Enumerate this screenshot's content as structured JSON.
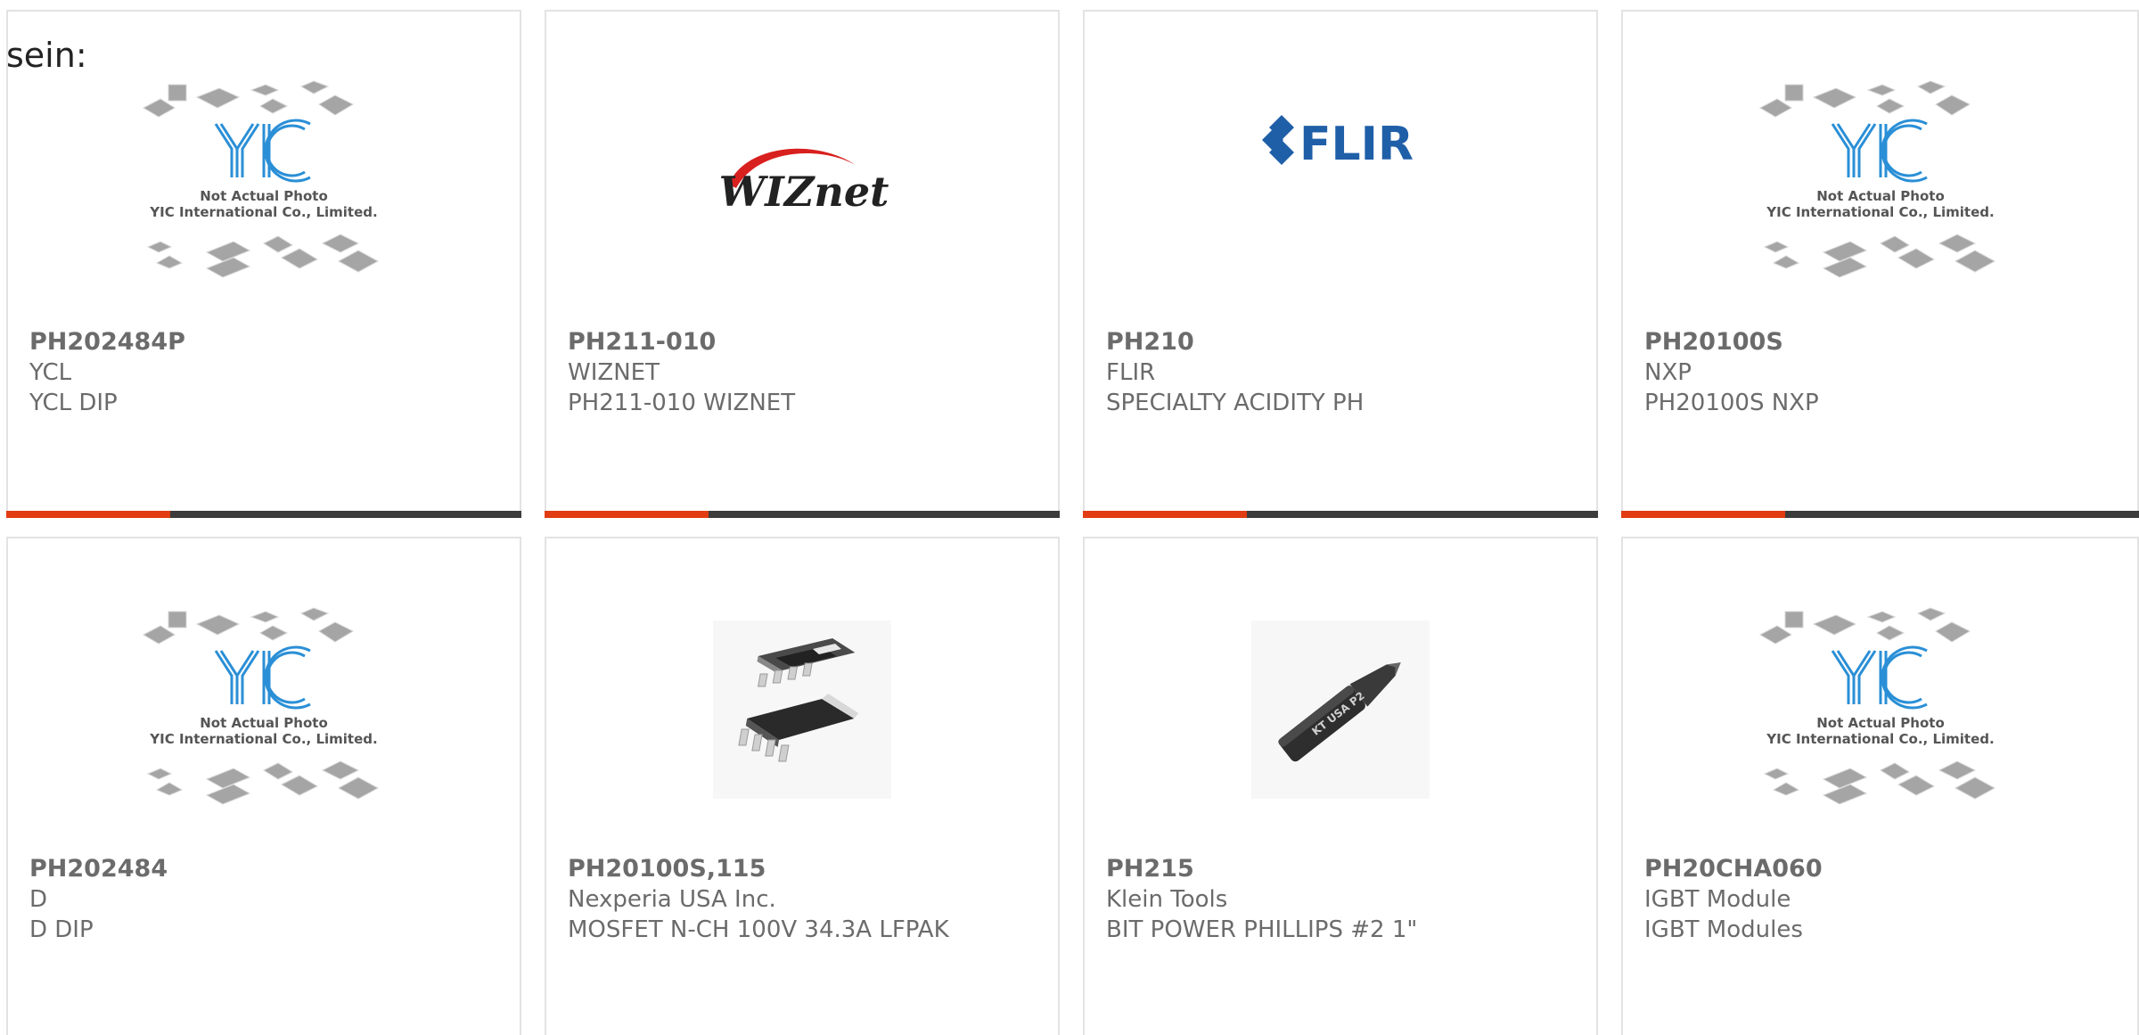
{
  "intro_text": "sein:",
  "products": [
    {
      "part": "PH202484P",
      "maker": "YCL",
      "desc": "YCL DIP",
      "image": "yic-placeholder",
      "placeholder_line1": "Not Actual Photo",
      "placeholder_line2": "YIC International Co., Limited.",
      "has_bar": true
    },
    {
      "part": "PH211-010",
      "maker": "WIZNET",
      "desc": "PH211-010 WIZNET",
      "image": "wiznet-logo",
      "logo_text": "WIZnet",
      "has_bar": true
    },
    {
      "part": "PH210",
      "maker": "FLIR",
      "desc": "SPECIALTY ACIDITY PH",
      "image": "flir-logo",
      "logo_text": "FLIR",
      "has_bar": true
    },
    {
      "part": "PH20100S",
      "maker": "NXP",
      "desc": "PH20100S NXP",
      "image": "yic-placeholder",
      "placeholder_line1": "Not Actual Photo",
      "placeholder_line2": "YIC International Co., Limited.",
      "has_bar": true
    },
    {
      "part": "PH202484",
      "maker": "D",
      "desc": "D DIP",
      "image": "yic-placeholder",
      "placeholder_line1": "Not Actual Photo",
      "placeholder_line2": "YIC International Co., Limited.",
      "has_bar": false
    },
    {
      "part": "PH20100S,115",
      "maker": "Nexperia USA Inc.",
      "desc": "MOSFET N-CH 100V 34.3A LFPAK",
      "image": "lfpak-package",
      "has_bar": false
    },
    {
      "part": "PH215",
      "maker": "Klein Tools",
      "desc": "BIT POWER PHILLIPS #2 1\"",
      "image": "screwdriver-bit",
      "has_bar": false
    },
    {
      "part": "PH20CHA060",
      "maker": "IGBT Module",
      "desc": "IGBT Modules",
      "image": "yic-placeholder",
      "placeholder_line1": "Not Actual Photo",
      "placeholder_line2": "YIC International Co., Limited.",
      "has_bar": false
    }
  ],
  "colors": {
    "accent": "#e23c12",
    "bar_dark": "#3c3c3c",
    "text_gray": "#6b6b6b",
    "yic_blue": "#2a8fd6",
    "wiznet_red": "#d8201f",
    "flir_blue": "#1f5fa8"
  }
}
